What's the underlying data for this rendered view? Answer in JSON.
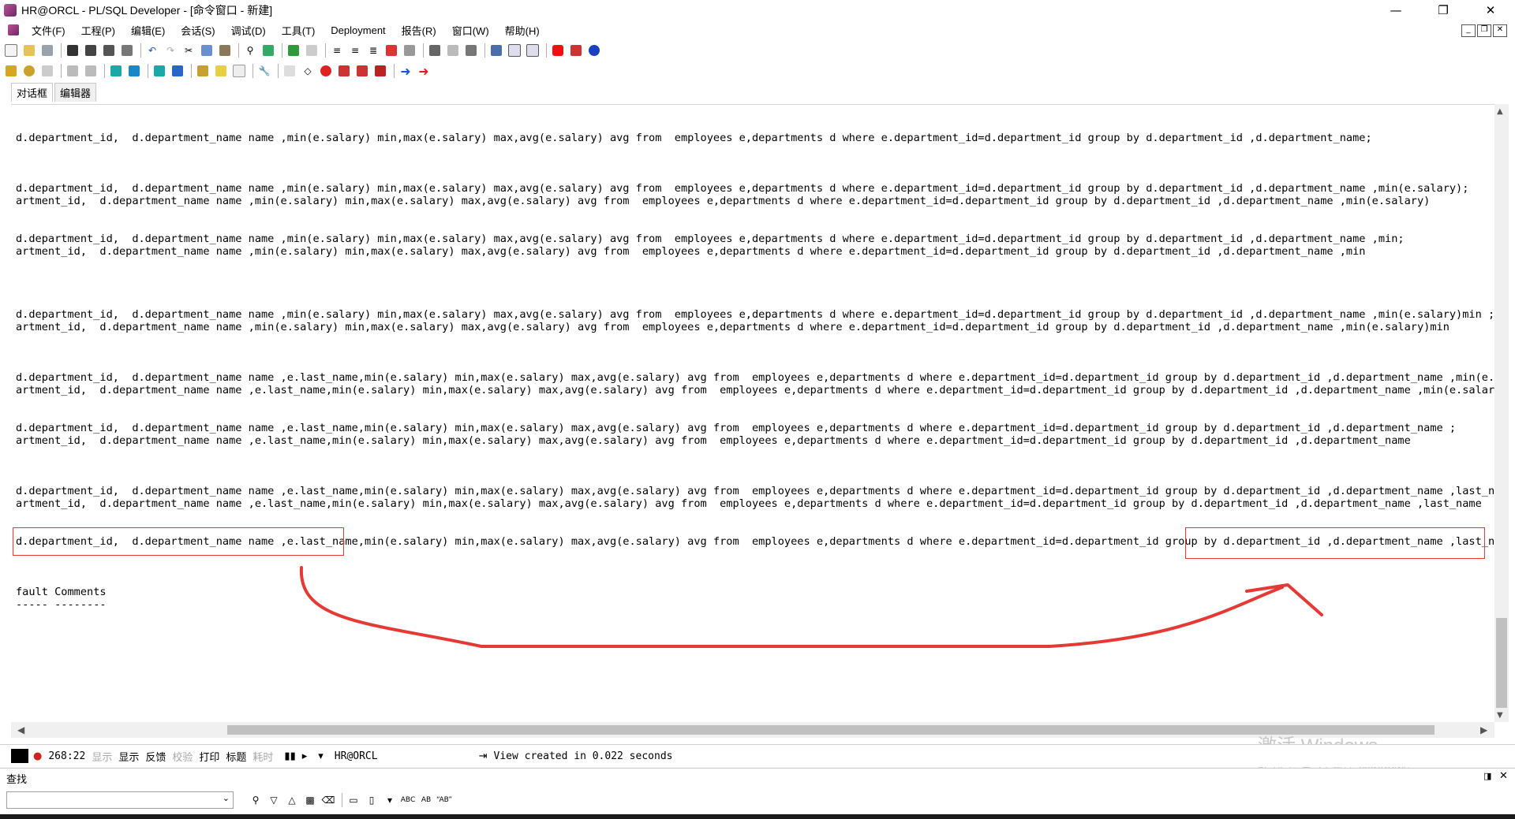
{
  "window": {
    "title": "HR@ORCL - PL/SQL Developer - [命令窗口 - 新建]",
    "controls": {
      "minimize": "—",
      "restore": "❐",
      "close": "✕"
    }
  },
  "menu": {
    "items": [
      "文件(F)",
      "工程(P)",
      "编辑(E)",
      "会话(S)",
      "调试(D)",
      "工具(T)",
      "Deployment",
      "报告(R)",
      "窗口(W)",
      "帮助(H)"
    ]
  },
  "tabs": {
    "dialog": "对话框",
    "editor": "编辑器"
  },
  "editor": {
    "lines": [
      "d.department_id,  d.department_name name ,min(e.salary) min,max(e.salary) max,avg(e.salary) avg from  employees e,departments d where e.department_id=d.department_id group by d.department_id ,d.department_name;",
      "d.department_id,  d.department_name name ,min(e.salary) min,max(e.salary) max,avg(e.salary) avg from  employees e,departments d where e.department_id=d.department_id group by d.department_id ,d.department_name ,min(e.salary);",
      "artment_id,  d.department_name name ,min(e.salary) min,max(e.salary) max,avg(e.salary) avg from  employees e,departments d where e.department_id=d.department_id group by d.department_id ,d.department_name ,min(e.salary)",
      "d.department_id,  d.department_name name ,min(e.salary) min,max(e.salary) max,avg(e.salary) avg from  employees e,departments d where e.department_id=d.department_id group by d.department_id ,d.department_name ,min;",
      "artment_id,  d.department_name name ,min(e.salary) min,max(e.salary) max,avg(e.salary) avg from  employees e,departments d where e.department_id=d.department_id group by d.department_id ,d.department_name ,min",
      "d.department_id,  d.department_name name ,min(e.salary) min,max(e.salary) max,avg(e.salary) avg from  employees e,departments d where e.department_id=d.department_id group by d.department_id ,d.department_name ,min(e.salary)min ;",
      "artment_id,  d.department_name name ,min(e.salary) min,max(e.salary) max,avg(e.salary) avg from  employees e,departments d where e.department_id=d.department_id group by d.department_id ,d.department_name ,min(e.salary)min",
      "d.department_id,  d.department_name name ,e.last_name,min(e.salary) min,max(e.salary) max,avg(e.salary) avg from  employees e,departments d where e.department_id=d.department_id group by d.department_id ,d.department_name ,min(e.salary",
      "artment_id,  d.department_name name ,e.last_name,min(e.salary) min,max(e.salary) max,avg(e.salary) avg from  employees e,departments d where e.department_id=d.department_id group by d.department_id ,d.department_name ,min(e.salary)min",
      "d.department_id,  d.department_name name ,e.last_name,min(e.salary) min,max(e.salary) max,avg(e.salary) avg from  employees e,departments d where e.department_id=d.department_id group by d.department_id ,d.department_name ;",
      "artment_id,  d.department_name name ,e.last_name,min(e.salary) min,max(e.salary) max,avg(e.salary) avg from  employees e,departments d where e.department_id=d.department_id group by d.department_id ,d.department_name",
      "d.department_id,  d.department_name name ,e.last_name,min(e.salary) min,max(e.salary) max,avg(e.salary) avg from  employees e,departments d where e.department_id=d.department_id group by d.department_id ,d.department_name ,last_name;",
      "artment_id,  d.department_name name ,e.last_name,min(e.salary) min,max(e.salary) max,avg(e.salary) avg from  employees e,departments d where e.department_id=d.department_id group by d.department_id ,d.department_name ,last_name",
      "d.department_id,  d.department_name name ,e.last_name,min(e.salary) min,max(e.salary) max,avg(e.salary) avg from  employees e,departments d where e.department_id=d.department_id group by d.department_id ,d.department_name ,last_name;",
      "fault Comments",
      "----- --------"
    ]
  },
  "status": {
    "position": "268:22",
    "labels": [
      "显示",
      "显示",
      "反馈",
      "校验",
      "打印",
      "标题",
      "耗时"
    ],
    "connection": "HR@ORCL",
    "message": "View created in 0.022 seconds"
  },
  "find": {
    "title": "查找",
    "input_value": ""
  },
  "watermark": {
    "line1": "激活 Windows",
    "line2": "转到\"设置\"以激活 Windows。"
  },
  "colors": {
    "annotation": "#e53935",
    "text": "#000000",
    "scrollbar_thumb": "#c0c0c0"
  }
}
